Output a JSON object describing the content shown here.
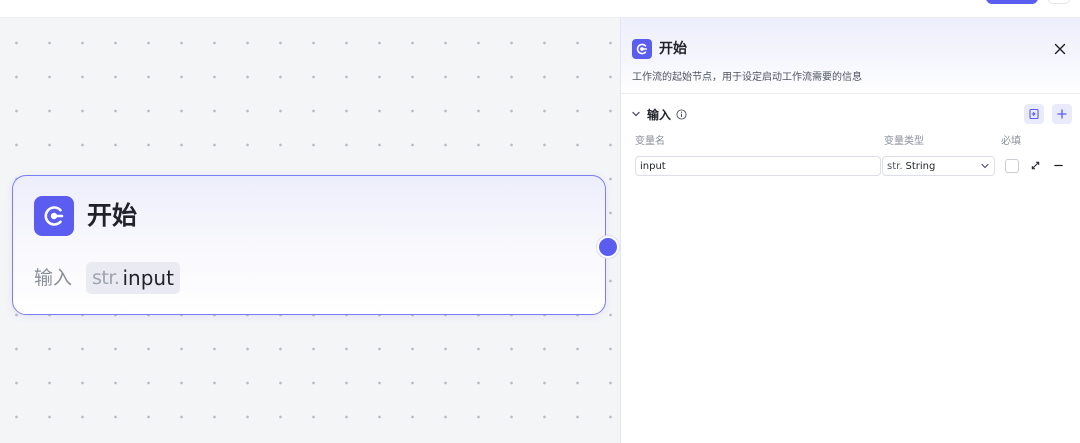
{
  "node": {
    "title": "开始",
    "input_label": "输入",
    "var_type_short": "str.",
    "var_name": "input"
  },
  "panel": {
    "title": "开始",
    "description": "工作流的起始节点，用于设定启动工作流需要的信息",
    "section_title": "输入",
    "columns": {
      "name": "变量名",
      "type": "变量类型",
      "required": "必填"
    },
    "row": {
      "name_value": "input",
      "type_prefix": "str.",
      "type_name": "String",
      "required": false
    }
  },
  "icons": {
    "node_icon": "start-flow-icon",
    "close": "close-icon",
    "collapse": "chevron-down-icon",
    "info": "info-icon",
    "import": "import-icon",
    "add": "plus-icon",
    "dropdown": "chevron-down-icon",
    "expand": "expand-icon",
    "remove": "minus-icon"
  },
  "colors": {
    "accent": "#5b5cf0",
    "node_border": "#7b7ef3",
    "canvas_bg": "#f4f5f7",
    "dot": "#b9bcc4"
  }
}
